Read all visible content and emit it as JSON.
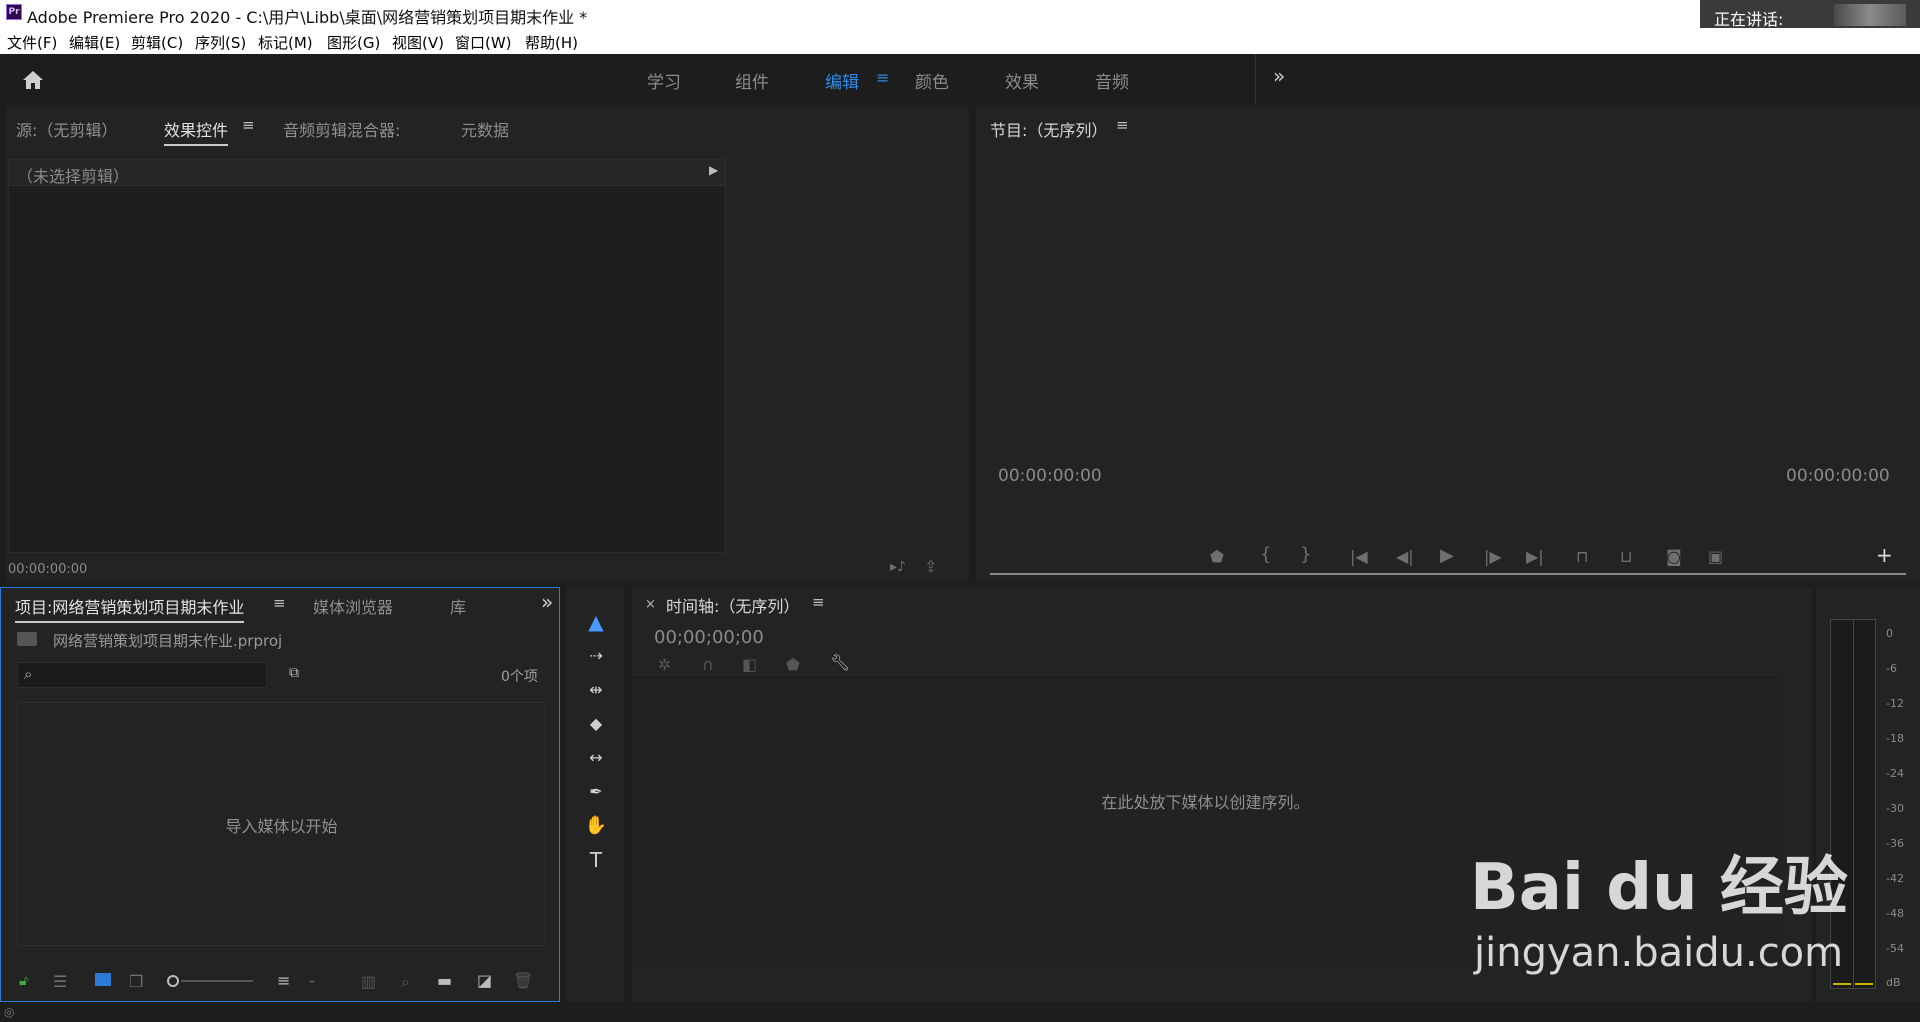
{
  "window": {
    "title": "Adobe Premiere Pro 2020 - C:\\用户\\Libb\\桌面\\网络营销策划项目期末作业 *",
    "app_icon": "Pr",
    "speaking_label": "正在讲话:"
  },
  "menu": [
    "文件(F)",
    "编辑(E)",
    "剪辑(C)",
    "序列(S)",
    "标记(M)",
    "图形(G)",
    "视图(V)",
    "窗口(W)",
    "帮助(H)"
  ],
  "workspaces": {
    "tabs": [
      "学习",
      "组件",
      "编辑",
      "颜色",
      "效果",
      "音频"
    ],
    "active": "编辑"
  },
  "source_panel": {
    "tabs": [
      "源:（无剪辑）",
      "效果控件",
      "音频剪辑混合器:",
      "元数据"
    ],
    "active_tab": "效果控件",
    "no_clip": "（未选择剪辑）",
    "timecode": "00:00:00:00"
  },
  "program_panel": {
    "title": "节目:（无序列）",
    "timecode_left": "00:00:00:00",
    "timecode_right": "00:00:00:00"
  },
  "project_panel": {
    "tabs": [
      "项目:网络营销策划项目期末作业",
      "媒体浏览器",
      "库"
    ],
    "active_tab": "项目:网络营销策划项目期末作业",
    "file_name": "网络营销策划项目期末作业.prproj",
    "search_placeholder": "",
    "item_count": "0个项",
    "empty_message": "导入媒体以开始"
  },
  "timeline_panel": {
    "title": "时间轴:（无序列）",
    "timecode": "00;00;00;00",
    "drop_message": "在此处放下媒体以创建序列。"
  },
  "audio_meter": {
    "scale": [
      "0",
      "-6",
      "-12",
      "-18",
      "-24",
      "-30",
      "-36",
      "-42",
      "-48",
      "-54",
      "dB"
    ]
  },
  "watermark": {
    "brand": "Bai du 经验",
    "url": "jingyan.baidu.com"
  },
  "colors": {
    "accent": "#2d8ceb",
    "panel_bg": "#232323",
    "app_bg": "#1d1d1d",
    "focus_border": "#2d7ad6",
    "tool_active": "#4a9bff",
    "lock_green": "#3fae3f"
  }
}
